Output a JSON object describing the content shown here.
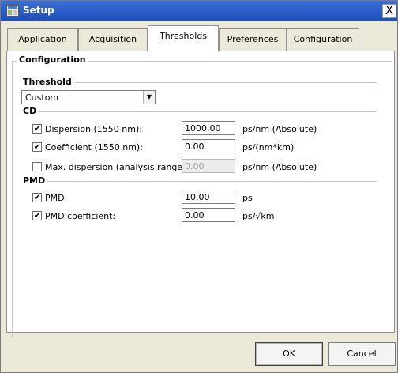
{
  "window": {
    "title": "Setup",
    "close_symbol": "X",
    "icon": "app-window-icon"
  },
  "tabs": [
    {
      "label": "Application",
      "active": false
    },
    {
      "label": "Acquisition",
      "active": false
    },
    {
      "label": "Thresholds",
      "active": true
    },
    {
      "label": "Preferences",
      "active": false
    },
    {
      "label": "Configuration",
      "active": false
    }
  ],
  "config_group": {
    "title": "Configuration",
    "threshold": {
      "label": "Threshold",
      "selected": "Custom"
    },
    "cd": {
      "label": "CD",
      "rows": [
        {
          "checked": true,
          "label": "Dispersion (1550 nm):",
          "value": "1000.00",
          "unit": "ps/nm  (Absolute)",
          "enabled": true
        },
        {
          "checked": true,
          "label": "Coefficient (1550 nm):",
          "value": "0.00",
          "unit": "ps/(nm*km)",
          "enabled": true
        },
        {
          "checked": false,
          "label": "Max. dispersion (analysis range):",
          "value": "0.00",
          "unit": "ps/nm  (Absolute)",
          "enabled": false
        }
      ]
    },
    "pmd": {
      "label": "PMD",
      "rows": [
        {
          "checked": true,
          "label": "PMD:",
          "value": "10.00",
          "unit": "ps",
          "enabled": true
        },
        {
          "checked": true,
          "label": "PMD coefficient:",
          "value": "0.00",
          "unit": "ps/√km",
          "enabled": true
        }
      ]
    }
  },
  "buttons": {
    "ok": "OK",
    "cancel": "Cancel"
  },
  "colors": {
    "titlebar": "#1e4fb8",
    "dialog_bg": "#ece9d8",
    "panel_bg": "#ffffff"
  }
}
